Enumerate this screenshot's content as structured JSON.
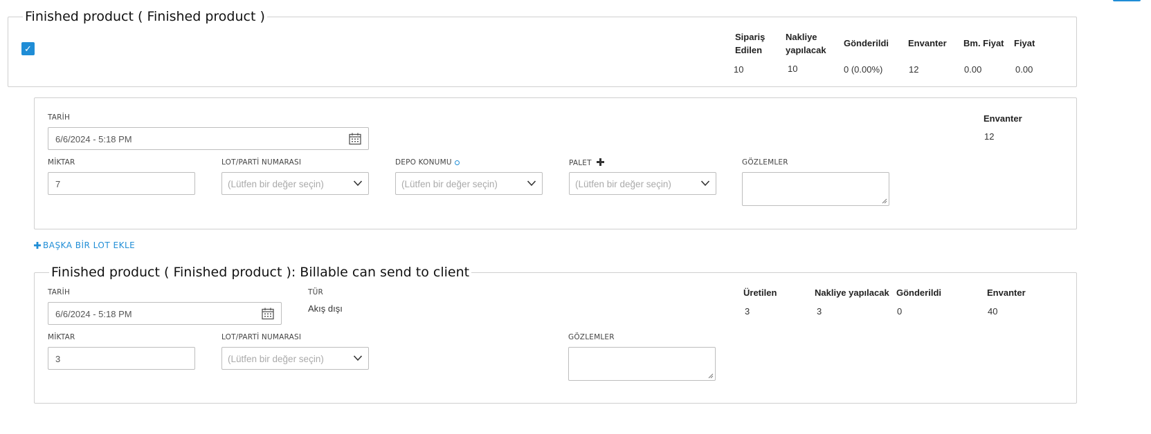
{
  "product": {
    "title": "Finished product ( Finished product )",
    "checked": true,
    "headers": {
      "siparis_edilen_1": "Sipariş",
      "siparis_edilen_2": "Edilen",
      "nakliye_1": "Nakliye",
      "nakliye_2": "yapılacak",
      "gonderildi": "Gönderildi",
      "envanter": "Envanter",
      "bm_fiyat": "Bm. Fiyat",
      "fiyat": "Fiyat"
    },
    "values": {
      "siparis_edilen": "10",
      "nakliye": "10",
      "gonderildi": "0 (0.00%)",
      "envanter": "12",
      "bm_fiyat": "0.00",
      "fiyat": "0.00"
    }
  },
  "lot_form": {
    "date_label": "TARİH",
    "date_value": "6/6/2024 - 5:18 PM",
    "qty_label": "MİKTAR",
    "qty_value": "7",
    "lot_label": "LOT/PARTİ NUMARASI",
    "lot_placeholder": "(Lütfen bir değer seçin)",
    "depo_label": "DEPO KONUMU",
    "depo_placeholder": "(Lütfen bir değer seçin)",
    "palet_label": "PALET",
    "palet_placeholder": "(Lütfen bir değer seçin)",
    "notes_label": "GÖZLEMLER",
    "envanter_label": "Envanter",
    "envanter_value": "12"
  },
  "add_lot_label": "BAŞKA BİR LOT EKLE",
  "production": {
    "title": "Finished product ( Finished product ): Billable can send to client",
    "date_label": "TARİH",
    "date_value": "6/6/2024 - 5:18 PM",
    "type_label": "TÜR",
    "type_value": "Akış dışı",
    "qty_label": "MİKTAR",
    "qty_value": "3",
    "lot_label": "LOT/PARTİ NUMARASI",
    "lot_placeholder": "(Lütfen bir değer seçin)",
    "notes_label": "GÖZLEMLER",
    "headers": {
      "uretilen": "Üretilen",
      "nakliye": "Nakliye yapılacak",
      "gonderildi": "Gönderildi",
      "envanter": "Envanter"
    },
    "values": {
      "uretilen": "3",
      "nakliye": "3",
      "gonderildi": "0",
      "envanter": "40"
    }
  }
}
